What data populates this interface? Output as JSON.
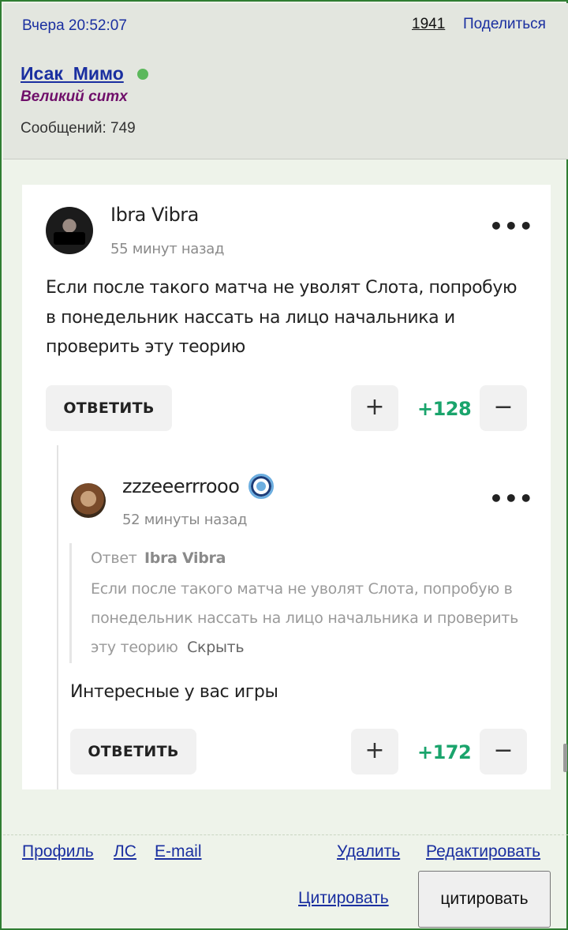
{
  "post": {
    "time": "Вчера 20:52:07",
    "number": "1941",
    "share": "Поделиться",
    "author": {
      "name": "Исак_Мимо",
      "rank": "Великий ситх",
      "posts": "Сообщений: 749",
      "online_color": "#5cb85c"
    }
  },
  "embed": {
    "comment": {
      "author": "Ibra Vibra",
      "time": "55 минут назад",
      "text_lines": [
        "Если после такого матча не уволят Слота, попробую",
        "в понедельник нассать на лицо начальника и",
        "проверить эту теорию"
      ],
      "reply_label": "ОТВЕТИТЬ",
      "upvote": "+",
      "downvote": "−",
      "score": "+128",
      "more": "•••"
    },
    "reply": {
      "author": "zzzeeerrrooo",
      "time": "52 минуты назад",
      "quote_label": "Ответ",
      "quote_author": "Ibra Vibra",
      "quote_lines": [
        "Если после такого матча не уволят Слота, попробую в",
        "понедельник нассать на лицо начальника и проверить",
        "эту теорию"
      ],
      "hide_label": "Скрыть",
      "text": "Интересные у вас игры",
      "reply_label": "ОТВЕТИТЬ",
      "upvote": "+",
      "downvote": "−",
      "score": "+172",
      "more": "•••",
      "badge_icon": "manchester-city-badge-icon"
    },
    "score_color": "#1aa46c"
  },
  "footer": {
    "profile": "Профиль",
    "pm": "ЛС",
    "email": "E-mail",
    "delete": "Удалить",
    "edit": "Редактировать",
    "quote_link": "Цитировать",
    "quote_button": "цитировать"
  },
  "colors": {
    "frame_border": "#2f7d32",
    "link": "#1a2fa0",
    "rank": "#6f0f6a"
  }
}
